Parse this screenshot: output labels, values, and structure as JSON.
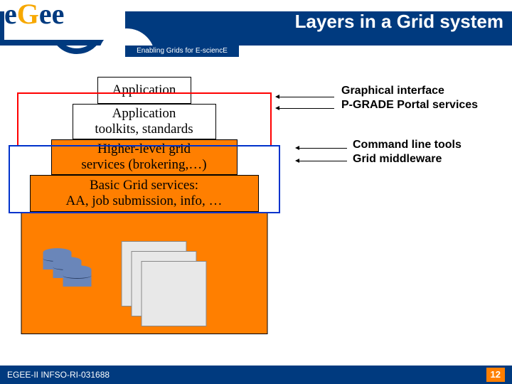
{
  "header": {
    "title": "Layers in a Grid system",
    "tagline": "Enabling Grids for E-sciencE",
    "logo_text": "eGee"
  },
  "layers": {
    "l0": "Application",
    "l1": "Application\ntoolkits, standards",
    "l2": "Higher-level grid\nservices (brokering,…)",
    "l3": "Basic Grid services:\nAA, job submission, info, …",
    "l4": ""
  },
  "annotations": {
    "group1_line1": "Graphical interface",
    "group1_line2": "P-GRADE Portal services",
    "group2_line1": "Command line tools",
    "group2_line2": "Grid middleware"
  },
  "footer": {
    "left": "EGEE-II INFSO-RI-031688",
    "page": "12"
  }
}
